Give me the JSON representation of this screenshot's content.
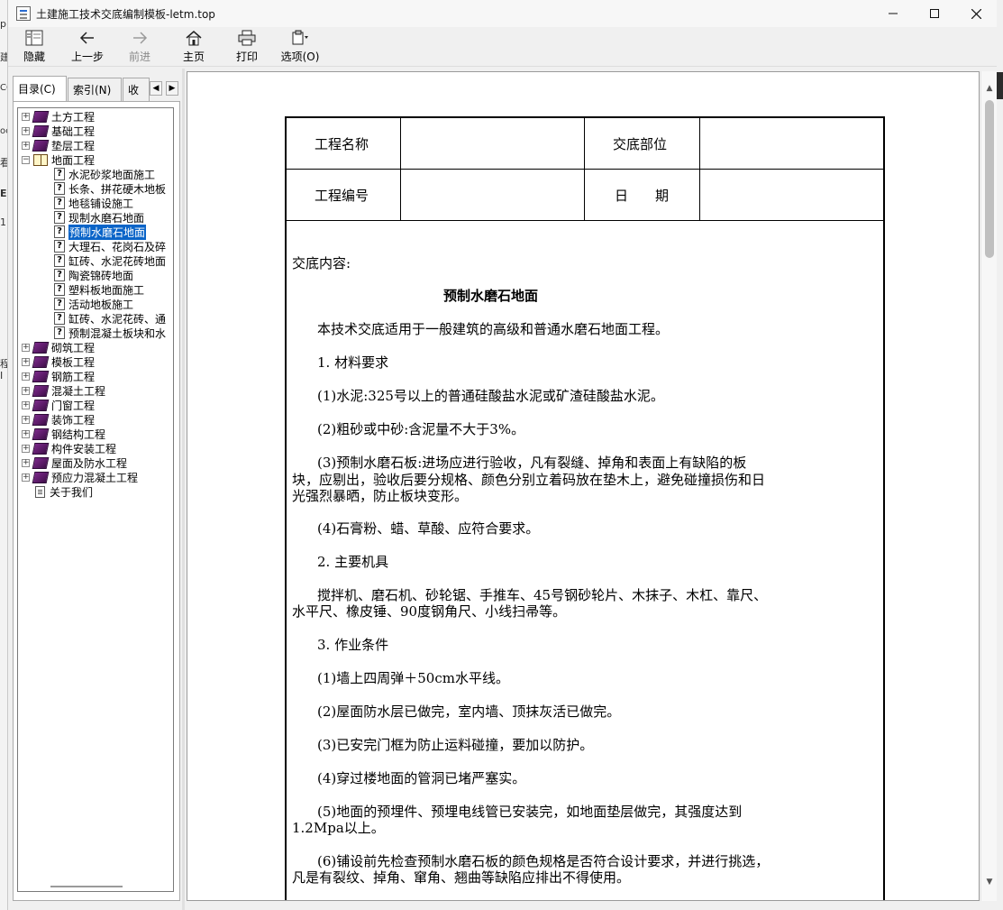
{
  "window": {
    "title": "土建施工技术交底编制模板-letm.top"
  },
  "toolbar": {
    "hide": "隐藏",
    "back": "上一步",
    "forward": "前进",
    "home": "主页",
    "print": "打印",
    "options": "选项(O)"
  },
  "tabs": {
    "contents": "目录(C)",
    "index": "索引(N)",
    "search": "收"
  },
  "tree": {
    "items": [
      {
        "label": "土方工程",
        "type": "book-closed",
        "level": 0,
        "expander": "+"
      },
      {
        "label": "基础工程",
        "type": "book-closed",
        "level": 0,
        "expander": "+"
      },
      {
        "label": "垫层工程",
        "type": "book-closed",
        "level": 0,
        "expander": "+"
      },
      {
        "label": "地面工程",
        "type": "book-open",
        "level": 0,
        "expander": "−"
      },
      {
        "label": "水泥砂浆地面施工",
        "type": "topic",
        "level": 1
      },
      {
        "label": "长条、拼花硬木地板",
        "type": "topic",
        "level": 1
      },
      {
        "label": "地毯铺设施工",
        "type": "topic",
        "level": 1
      },
      {
        "label": "现制水磨石地面",
        "type": "topic",
        "level": 1
      },
      {
        "label": "预制水磨石地面",
        "type": "topic",
        "level": 1,
        "selected": true
      },
      {
        "label": "大理石、花岗石及碎",
        "type": "topic",
        "level": 1
      },
      {
        "label": "缸砖、水泥花砖地面",
        "type": "topic",
        "level": 1
      },
      {
        "label": "陶瓷锦砖地面",
        "type": "topic",
        "level": 1
      },
      {
        "label": "塑料板地面施工",
        "type": "topic",
        "level": 1
      },
      {
        "label": "活动地板施工",
        "type": "topic",
        "level": 1
      },
      {
        "label": "缸砖、水泥花砖、通",
        "type": "topic",
        "level": 1
      },
      {
        "label": "预制混凝土板块和水",
        "type": "topic",
        "level": 1
      },
      {
        "label": "砌筑工程",
        "type": "book-closed",
        "level": 0,
        "expander": "+"
      },
      {
        "label": "模板工程",
        "type": "book-closed",
        "level": 0,
        "expander": "+"
      },
      {
        "label": "钢筋工程",
        "type": "book-closed",
        "level": 0,
        "expander": "+"
      },
      {
        "label": "混凝土工程",
        "type": "book-closed",
        "level": 0,
        "expander": "+"
      },
      {
        "label": "门窗工程",
        "type": "book-closed",
        "level": 0,
        "expander": "+"
      },
      {
        "label": "装饰工程",
        "type": "book-closed",
        "level": 0,
        "expander": "+"
      },
      {
        "label": "钢结构工程",
        "type": "book-closed",
        "level": 0,
        "expander": "+"
      },
      {
        "label": "构件安装工程",
        "type": "book-closed",
        "level": 0,
        "expander": "+"
      },
      {
        "label": "屋面及防水工程",
        "type": "book-closed",
        "level": 0,
        "expander": "+"
      },
      {
        "label": "预应力混凝土工程",
        "type": "book-closed",
        "level": 0,
        "expander": "+"
      },
      {
        "label": "关于我们",
        "type": "page",
        "level": 0
      }
    ]
  },
  "document": {
    "header": {
      "project_name_label": "工程名称",
      "project_name_value": "",
      "location_label": "交底部位",
      "location_value": "",
      "project_no_label": "工程编号",
      "project_no_value": "",
      "date_label": "日　　期",
      "date_value": ""
    },
    "content_label": "交底内容:",
    "title": "预制水磨石地面",
    "lines": [
      "本技术交底适用于一般建筑的高级和普通水磨石地面工程。",
      "1. 材料要求",
      "(1)水泥:325号以上的普通硅酸盐水泥或矿渣硅酸盐水泥。",
      "(2)粗砂或中砂:含泥量不大于3%。",
      "(3)预制水磨石板:进场应进行验收，凡有裂缝、掉角和表面上有缺陷的板",
      "块，应剔出，验收后要分规格、颜色分别立着码放在垫木上，避免碰撞损伤和日",
      "光强烈暴晒，防止板块变形。",
      "(4)石膏粉、蜡、草酸、应符合要求。",
      "2. 主要机具",
      "搅拌机、磨石机、砂轮锯、手推车、45号钢砂轮片、木抹子、木杠、靠尺、",
      "水平尺、橡皮锤、90度钢角尺、小线扫帚等。",
      "3. 作业条件",
      "(1)墙上四周弹＋50cm水平线。",
      "(2)屋面防水层已做完，室内墙、顶抹灰活已做完。",
      "(3)已安完门框为防止运料碰撞，要加以防护。",
      " (4)穿过楼地面的管洞已堵严塞实。",
      "(5)地面的预埋件、预埋电线管已安装完，如地面垫层做完，其强度达到",
      "1.2Mpa以上。",
      "(6)铺设前先检查预制水磨石板的颜色规格是否符合设计要求，并进行挑选，",
      "凡是有裂纹、掉角、窜角、翘曲等缺陷应排出不得使用。"
    ]
  },
  "background_fragments": [
    "p",
    "建",
    "CC",
    "oc",
    "看",
    "E",
    "1",
    "程",
    "I"
  ]
}
